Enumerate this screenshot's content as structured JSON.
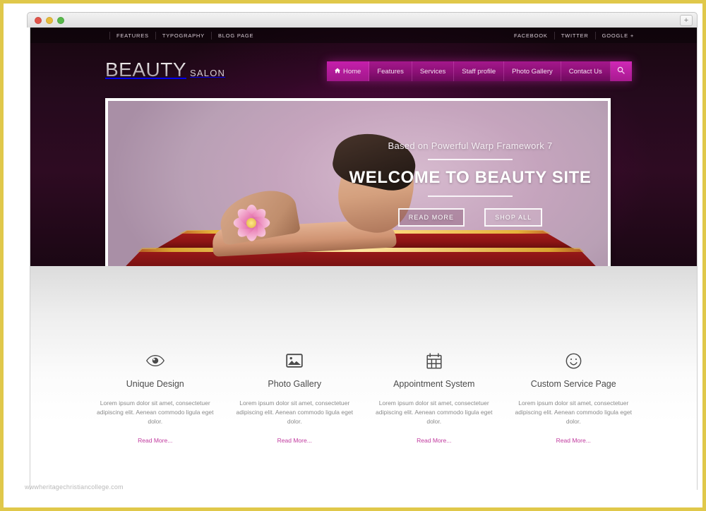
{
  "browser": {
    "new_tab_label": "+",
    "traffic_lights": [
      "close",
      "minimize",
      "maximize"
    ]
  },
  "topbar": {
    "left_links": [
      {
        "label": "FEATURES"
      },
      {
        "label": "TYPOGRAPHY"
      },
      {
        "label": "BLOG PAGE"
      }
    ],
    "right_links": [
      {
        "label": "FACEBOOK"
      },
      {
        "label": "TWITTER"
      },
      {
        "label": "GOOGLE +"
      }
    ]
  },
  "logo": {
    "main": "BEAUTY",
    "sub": "SALON"
  },
  "nav": {
    "items": [
      {
        "label": "Home",
        "icon": "home-icon",
        "active": true
      },
      {
        "label": "Features",
        "icon": "",
        "active": false
      },
      {
        "label": "Services",
        "icon": "",
        "active": false
      },
      {
        "label": "Staff profile",
        "icon": "",
        "active": false
      },
      {
        "label": "Photo Gallery",
        "icon": "",
        "active": false
      },
      {
        "label": "Contact Us",
        "icon": "",
        "active": false
      }
    ],
    "search_icon": "search-icon"
  },
  "hero": {
    "subtitle": "Based on Powerful Warp Framework 7",
    "title": "WELCOME TO BEAUTY SITE",
    "primary_button": "READ MORE",
    "secondary_button": "SHOP ALL"
  },
  "features": [
    {
      "icon": "eye-icon",
      "title": "Unique Design",
      "desc": "Lorem ipsum dolor sit amet, consectetuer adipiscing elit. Aenean commodo ligula eget dolor.",
      "link": "Read More..."
    },
    {
      "icon": "image-icon",
      "title": "Photo Gallery",
      "desc": "Lorem ipsum dolor sit amet, consectetuer adipiscing elit. Aenean commodo ligula eget dolor.",
      "link": "Read More..."
    },
    {
      "icon": "calendar-icon",
      "title": "Appointment System",
      "desc": "Lorem ipsum dolor sit amet, consectetuer adipiscing elit. Aenean commodo ligula eget dolor.",
      "link": "Read More..."
    },
    {
      "icon": "smiley-icon",
      "title": "Custom Service Page",
      "desc": "Lorem ipsum dolor sit amet, consectetuer adipiscing elit. Aenean commodo ligula eget dolor.",
      "link": "Read More..."
    }
  ],
  "watermark": "wwwheritagechristiancollege.com",
  "colors": {
    "frame": "#e0c84a",
    "header_dark": "#250a1d",
    "nav_magenta": "#a4188c",
    "nav_active": "#c51fab",
    "link_pink": "#c0399e",
    "hero_bg": "#c5a4bd",
    "step_red": "#8c1414",
    "step_gold": "#e5b23a"
  }
}
